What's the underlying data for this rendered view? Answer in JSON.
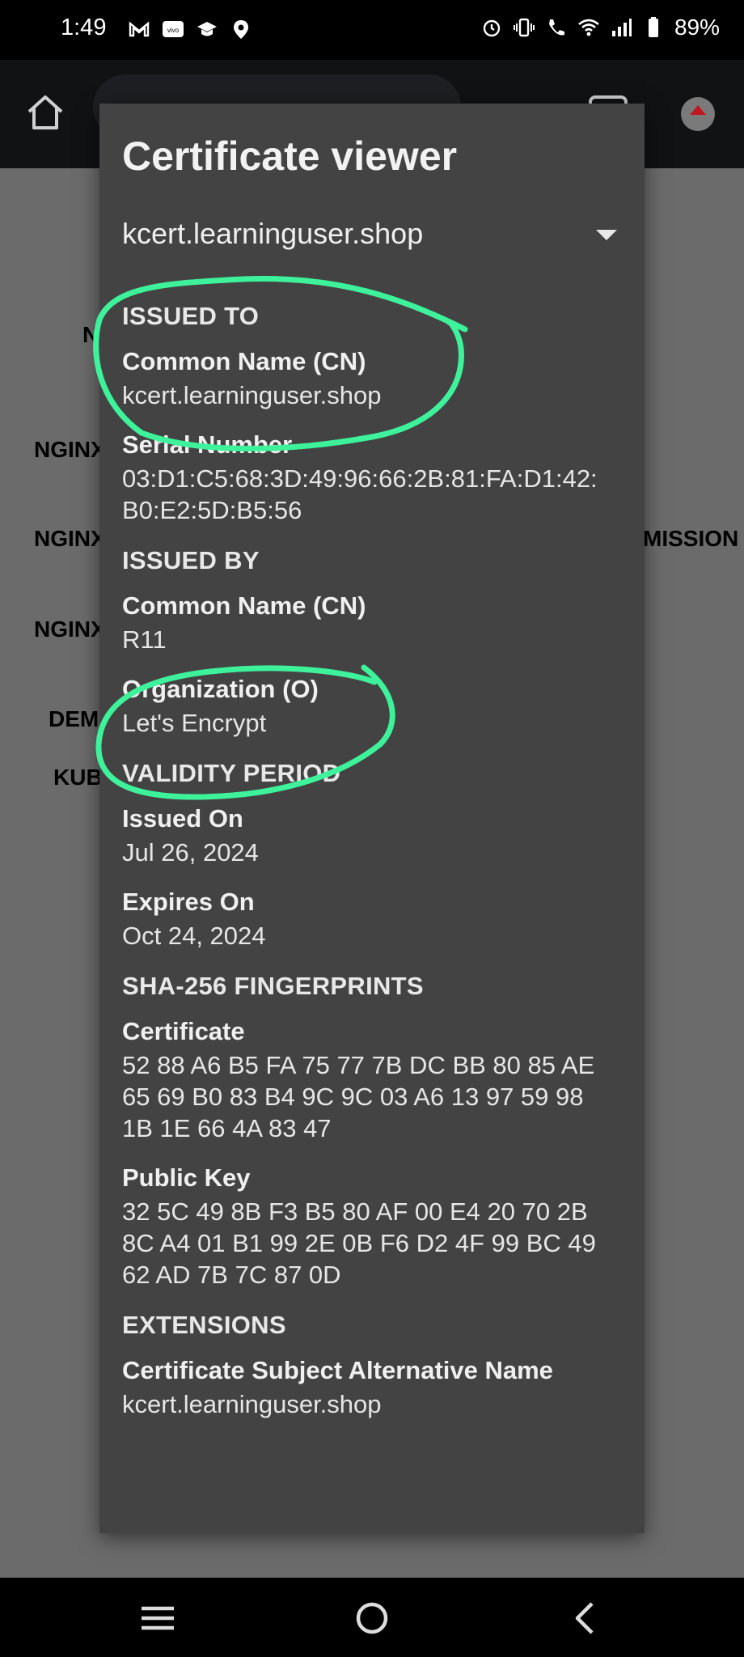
{
  "status_bar": {
    "time": "1:49",
    "battery": "89%",
    "left_icons": [
      "gmail-icon",
      "vivo-icon",
      "graduation-cap-icon",
      "location-icon"
    ],
    "right_icons": [
      "alarm-icon",
      "vibrate-icon",
      "wifi-calling-icon",
      "wifi-icon",
      "signal-icon",
      "battery-icon"
    ]
  },
  "background_page": {
    "texts": [
      "N",
      "NGINX",
      "NGINX",
      "MISSION",
      "NGINX",
      "DEM",
      "KUB"
    ]
  },
  "dialog": {
    "title": "Certificate viewer",
    "selected_certificate": "kcert.learninguser.shop",
    "sections": [
      {
        "heading": "ISSUED TO",
        "fields": [
          {
            "label": "Common Name (CN)",
            "value": "kcert.learninguser.shop"
          },
          {
            "label": "Serial Number",
            "value": "03:D1:C5:68:3D:49:96:66:2B:81:FA:D1:42:\nB0:E2:5D:B5:56"
          }
        ]
      },
      {
        "heading": "ISSUED BY",
        "fields": [
          {
            "label": "Common Name (CN)",
            "value": "R11"
          },
          {
            "label": "Organization (O)",
            "value": "Let's Encrypt"
          }
        ]
      },
      {
        "heading": "VALIDITY PERIOD",
        "fields": [
          {
            "label": "Issued On",
            "value": "Jul 26, 2024"
          },
          {
            "label": "Expires On",
            "value": "Oct 24, 2024"
          }
        ]
      },
      {
        "heading": "SHA-256 FINGERPRINTS",
        "fields": [
          {
            "label": "Certificate",
            "value": "52 88 A6 B5 FA 75 77 7B DC BB 80 85 AE\n65 69 B0 83 B4 9C 9C 03 A6 13 97 59 98\n1B 1E 66 4A 83 47"
          },
          {
            "label": "Public Key",
            "value": "32 5C 49 8B F3 B5 80 AF 00 E4 20 70 2B\n8C A4 01 B1 99 2E 0B F6 D2 4F 99 BC 49\n62 AD 7B 7C 87 0D"
          }
        ]
      },
      {
        "heading": "EXTENSIONS",
        "fields": [
          {
            "label": "Certificate Subject Alternative Name",
            "value": "kcert.learninguser.shop"
          }
        ]
      }
    ]
  },
  "annotation_color": "#3df29a",
  "nav_bar": {
    "buttons": [
      "menu-icon",
      "home-circle-icon",
      "back-icon"
    ]
  }
}
